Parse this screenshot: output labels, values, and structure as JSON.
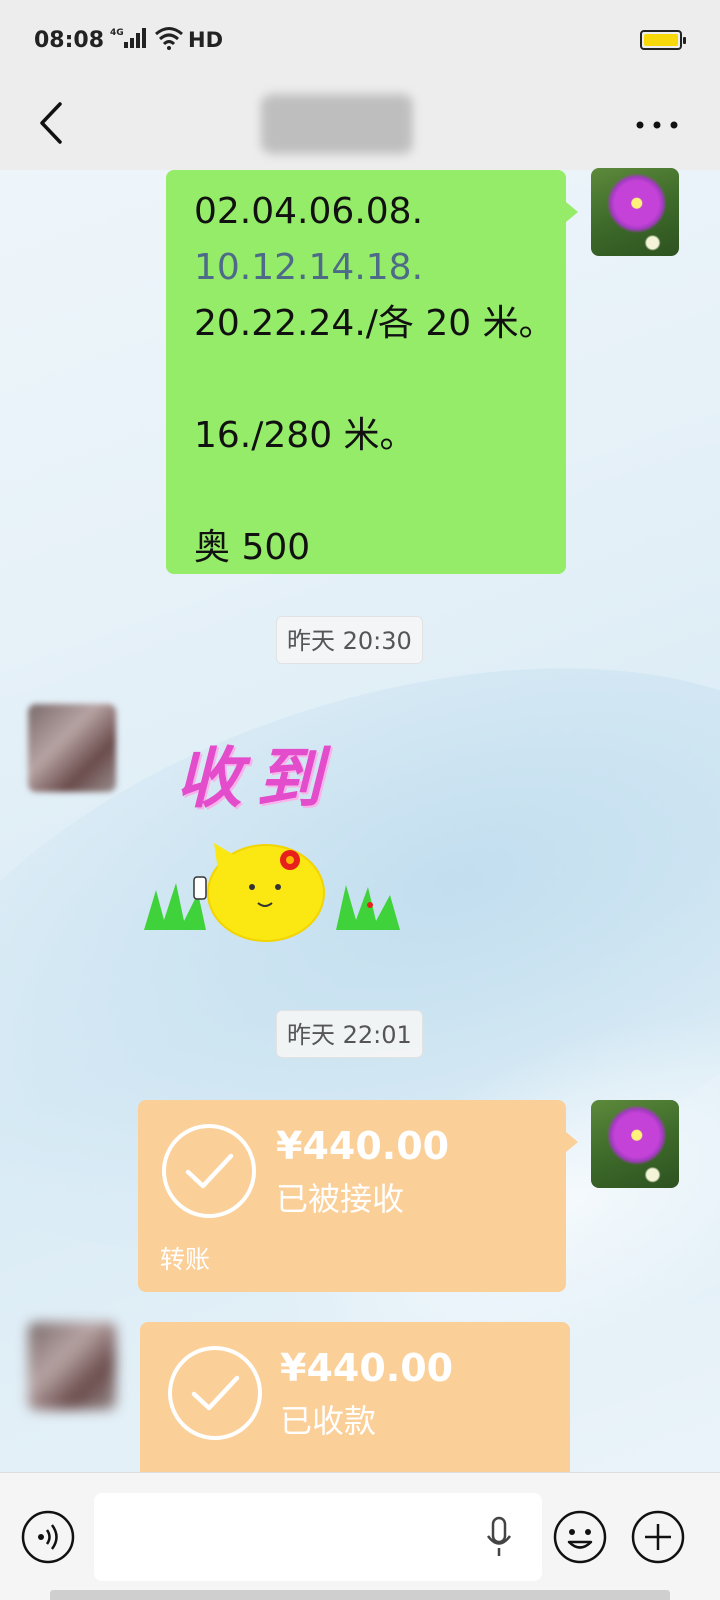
{
  "status_bar": {
    "time": "08:08",
    "network": "4G",
    "hd": "HD"
  },
  "header": {
    "title": "",
    "back_icon": "chevron-left-icon",
    "more_icon": "ellipsis-icon"
  },
  "messages": {
    "m1": {
      "lines": [
        "02.04.06.08.",
        "10.12.14.18.",
        "20.22.24./各 20 米。",
        "",
        "16./280 米。",
        "",
        "奥 500"
      ]
    },
    "ts1": "昨天 20:30",
    "sticker": {
      "text": "收到"
    },
    "ts2": "昨天 22:01",
    "transfer1": {
      "amount": "¥440.00",
      "status": "已被接收",
      "footer": "转账"
    },
    "transfer2": {
      "amount": "¥440.00",
      "status": "已收款"
    }
  },
  "input_bar": {
    "voice_icon": "voice-wave-icon",
    "emoji_icon": "emoji-icon",
    "plus_icon": "plus-icon",
    "mic_icon": "microphone-icon",
    "value": ""
  },
  "colors": {
    "sent_bubble": "#95ec69",
    "transfer_card": "#fbcf98",
    "header_bg": "#ededed",
    "battery": "#f7d80a"
  }
}
